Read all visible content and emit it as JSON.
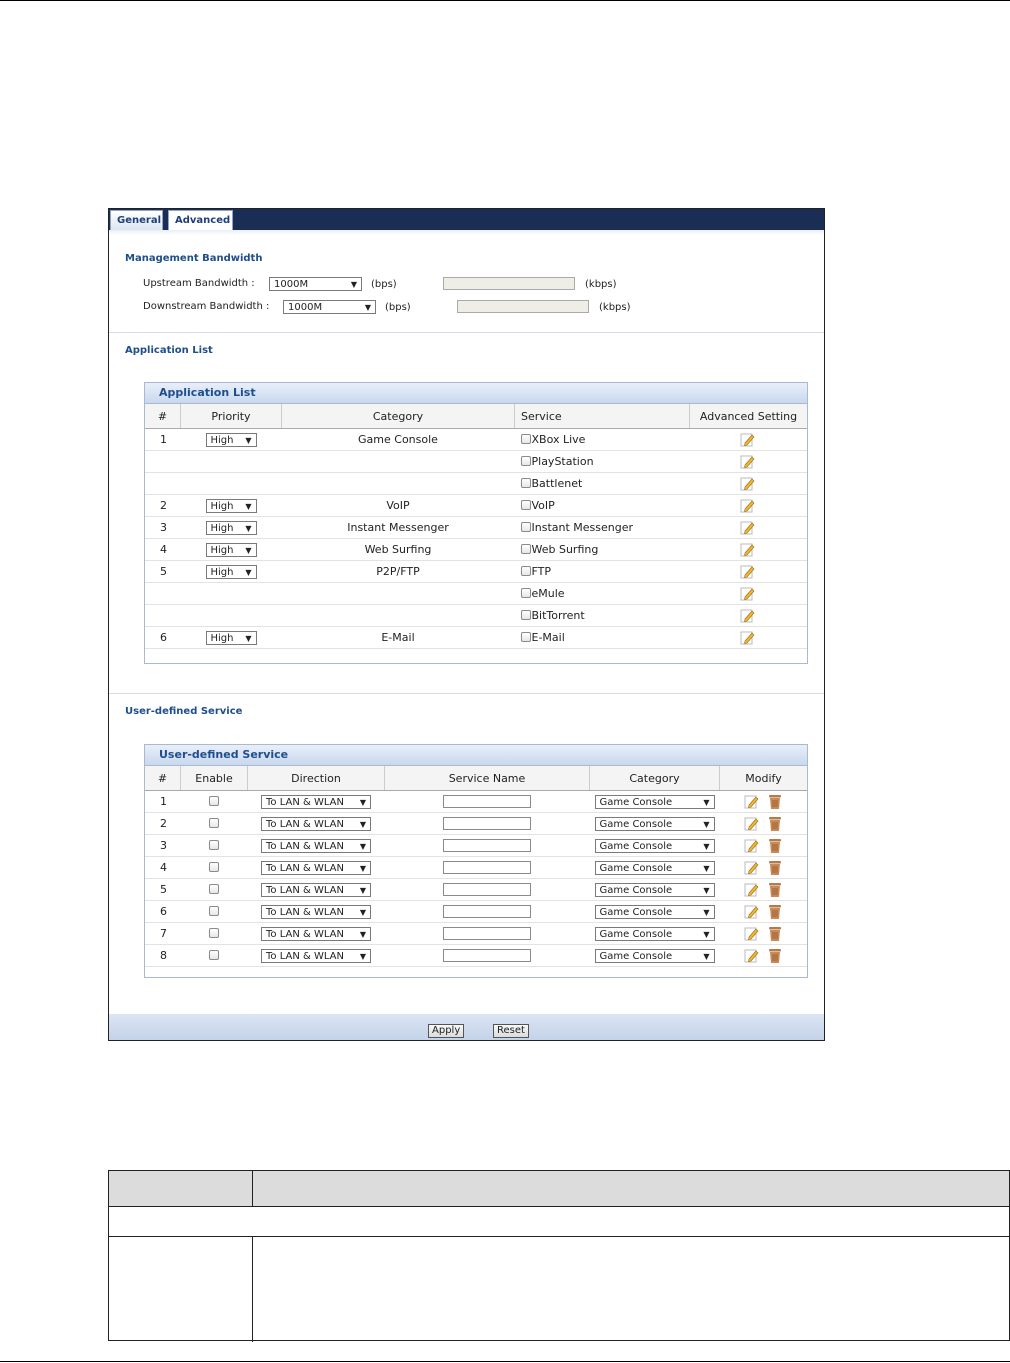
{
  "tabs": [
    {
      "label": "General"
    },
    {
      "label": "Advanced"
    }
  ],
  "management": {
    "title": "Management Bandwidth",
    "upstream_label": "Upstream Bandwidth :",
    "upstream_value": "1000M",
    "downstream_label": "Downstream Bandwidth :",
    "downstream_value": "1000M",
    "bps_unit": "(bps)",
    "kbps_unit": "(kbps)"
  },
  "app_section_title": "Application List",
  "app_panel": {
    "title": "Application List",
    "headers": [
      "#",
      "Priority",
      "Category",
      "Service",
      "Advanced Setting"
    ],
    "rows": [
      {
        "num": "1",
        "priority": "High",
        "category": "Game Console",
        "service": "XBox Live"
      },
      {
        "num": "",
        "priority": "",
        "category": "",
        "service": "PlayStation"
      },
      {
        "num": "",
        "priority": "",
        "category": "",
        "service": "Battlenet"
      },
      {
        "num": "2",
        "priority": "High",
        "category": "VoIP",
        "service": "VoIP"
      },
      {
        "num": "3",
        "priority": "High",
        "category": "Instant Messenger",
        "service": "Instant Messenger"
      },
      {
        "num": "4",
        "priority": "High",
        "category": "Web Surfing",
        "service": "Web Surfing"
      },
      {
        "num": "5",
        "priority": "High",
        "category": "P2P/FTP",
        "service": "FTP"
      },
      {
        "num": "",
        "priority": "",
        "category": "",
        "service": "eMule"
      },
      {
        "num": "",
        "priority": "",
        "category": "",
        "service": "BitTorrent"
      },
      {
        "num": "6",
        "priority": "High",
        "category": "E-Mail",
        "service": "E-Mail"
      }
    ]
  },
  "user_section_title": "User-defined Service",
  "user_panel": {
    "title": "User-defined Service",
    "headers": [
      "#",
      "Enable",
      "Direction",
      "Service Name",
      "Category",
      "Modify"
    ],
    "rows": [
      {
        "num": "1",
        "direction": "To LAN & WLAN",
        "service_name": "",
        "category": "Game Console"
      },
      {
        "num": "2",
        "direction": "To LAN & WLAN",
        "service_name": "",
        "category": "Game Console"
      },
      {
        "num": "3",
        "direction": "To LAN & WLAN",
        "service_name": "",
        "category": "Game Console"
      },
      {
        "num": "4",
        "direction": "To LAN & WLAN",
        "service_name": "",
        "category": "Game Console"
      },
      {
        "num": "5",
        "direction": "To LAN & WLAN",
        "service_name": "",
        "category": "Game Console"
      },
      {
        "num": "6",
        "direction": "To LAN & WLAN",
        "service_name": "",
        "category": "Game Console"
      },
      {
        "num": "7",
        "direction": "To LAN & WLAN",
        "service_name": "",
        "category": "Game Console"
      },
      {
        "num": "8",
        "direction": "To LAN & WLAN",
        "service_name": "",
        "category": "Game Console"
      }
    ]
  },
  "buttons": {
    "apply": "Apply",
    "reset": "Reset"
  },
  "icons": {
    "edit": "edit-pencil-icon",
    "delete": "trash-icon",
    "dropdown": "dropdown-arrow-icon"
  },
  "colors": {
    "tabbar": "#1a2d55",
    "section_title": "#1f4e8c",
    "panel_header": "#c9d8ee"
  }
}
